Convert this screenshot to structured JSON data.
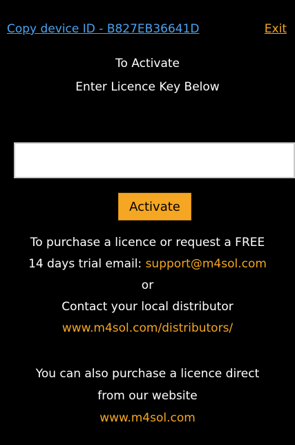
{
  "header": {
    "copy_device_id_label": "Copy device ID - B827EB36641D",
    "exit_label": "Exit"
  },
  "intro": {
    "line1": "To Activate",
    "line2": "Enter Licence Key Below"
  },
  "licence_input": {
    "value": "",
    "placeholder": ""
  },
  "activate_button_label": "Activate",
  "purchase_info": {
    "line1": "To purchase a licence or request a FREE",
    "line2_text": "14 days trial email:",
    "support_email": "support@m4sol.com",
    "or_text": "or",
    "distributor_text": "Contact your local distributor",
    "distributor_link": "www.m4sol.com/distributors/",
    "direct_line1": "You can also purchase a licence direct",
    "direct_line2": "from our website",
    "website_link": "www.m4sol.com"
  },
  "colors": {
    "background": "#000000",
    "link_blue": "#4aa3f0",
    "accent_orange": "#f5a623",
    "text": "#ffffff"
  }
}
